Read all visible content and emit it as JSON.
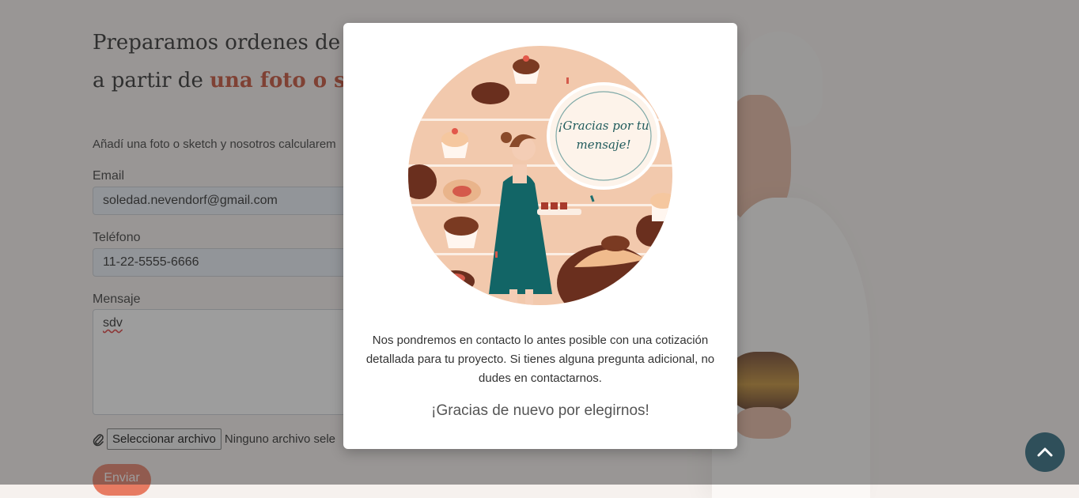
{
  "page": {
    "heading_line1": "Preparamos ordenes de cua",
    "heading_line2_prefix": "a partir de ",
    "heading_line2_accent": "una foto o sketc",
    "intro": "Añadí una foto o sketch y nosotros calcularem",
    "form": {
      "email_label": "Email",
      "email_value": "soledad.nevendorf@gmail.com",
      "phone_label": "Teléfono",
      "phone_value": "11-22-5555-6666",
      "message_label": "Mensaje",
      "message_value": "sdv",
      "file_button": "Seleccionar archivo",
      "file_status": "Ninguno archivo sele",
      "send_button": "Enviar"
    }
  },
  "modal": {
    "illustration_text": "¡Gracias por tu mensaje!",
    "message": "Nos pondremos en contacto lo antes posible con una cotización detallada para tu proyecto. Si tienes alguna pregunta adicional, no dudes en contactarnos.",
    "thanks": "¡Gracias de nuevo por elegirnos!"
  },
  "colors": {
    "accent": "#c2462d",
    "send_button": "#e77b62",
    "fab": "#2f4f5a",
    "illustration_bg": "#f2c9ad"
  },
  "icons": {
    "attach": "paperclip-icon",
    "scroll_top": "chevron-up-icon"
  }
}
